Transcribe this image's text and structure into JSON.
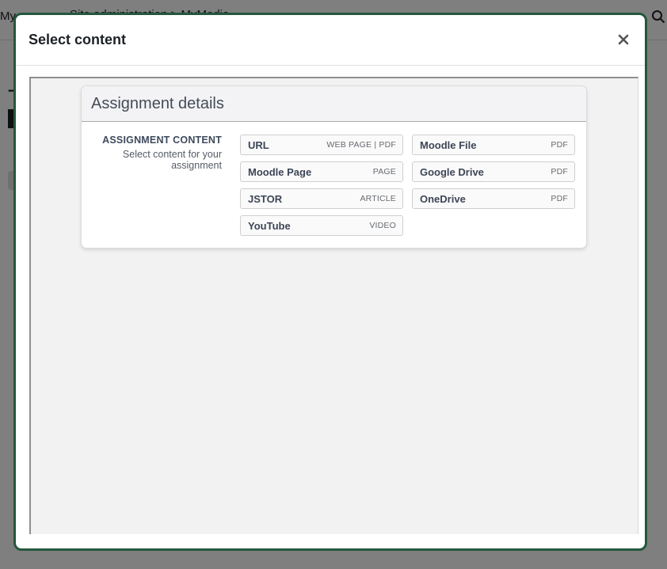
{
  "background": {
    "nav_my": "My",
    "nav_crumb": "Site administration > MyMedia",
    "heading_fragment": "T"
  },
  "modal": {
    "title": "Select content",
    "close_label": "×"
  },
  "card": {
    "title": "Assignment details",
    "section_title": "ASSIGNMENT CONTENT",
    "section_description": "Select content for your assignment",
    "options": [
      {
        "name": "URL",
        "type": "WEB PAGE | PDF"
      },
      {
        "name": "Moodle File",
        "type": "PDF"
      },
      {
        "name": "Moodle Page",
        "type": "PAGE"
      },
      {
        "name": "Google Drive",
        "type": "PDF"
      },
      {
        "name": "JSTOR",
        "type": "ARTICLE"
      },
      {
        "name": "OneDrive",
        "type": "PDF"
      },
      {
        "name": "YouTube",
        "type": "VIDEO"
      }
    ]
  },
  "colors": {
    "modal_border": "#24573d",
    "frame_background": "#f2f2f2",
    "overlay": "#7f7f7f"
  }
}
